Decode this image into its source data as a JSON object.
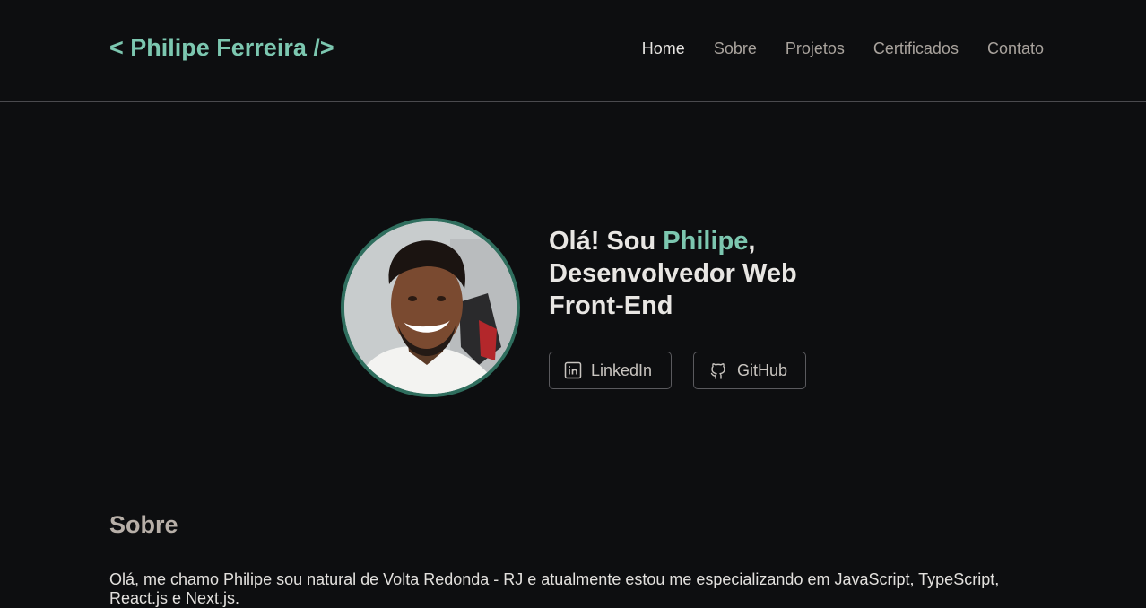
{
  "header": {
    "logo": "< Philipe Ferreira />",
    "nav": [
      {
        "label": "Home",
        "active": true
      },
      {
        "label": "Sobre",
        "active": false
      },
      {
        "label": "Projetos",
        "active": false
      },
      {
        "label": "Certificados",
        "active": false
      },
      {
        "label": "Contato",
        "active": false
      }
    ]
  },
  "hero": {
    "greeting_prefix": "Olá! Sou ",
    "name": "Philipe",
    "greeting_suffix": ",",
    "role_line1": "Desenvolvedor Web",
    "role_line2": "Front-End",
    "buttons": [
      {
        "label": "LinkedIn",
        "icon": "linkedin-icon"
      },
      {
        "label": "GitHub",
        "icon": "github-icon"
      }
    ]
  },
  "about": {
    "title": "Sobre",
    "text": "Olá, me chamo Philipe sou natural de Volta Redonda - RJ e atualmente estou me especializando em JavaScript, TypeScript, React.js e Next.js."
  },
  "colors": {
    "background": "#0d0e10",
    "accent": "#7cc7b0",
    "avatar_ring": "#2f6e5e"
  }
}
